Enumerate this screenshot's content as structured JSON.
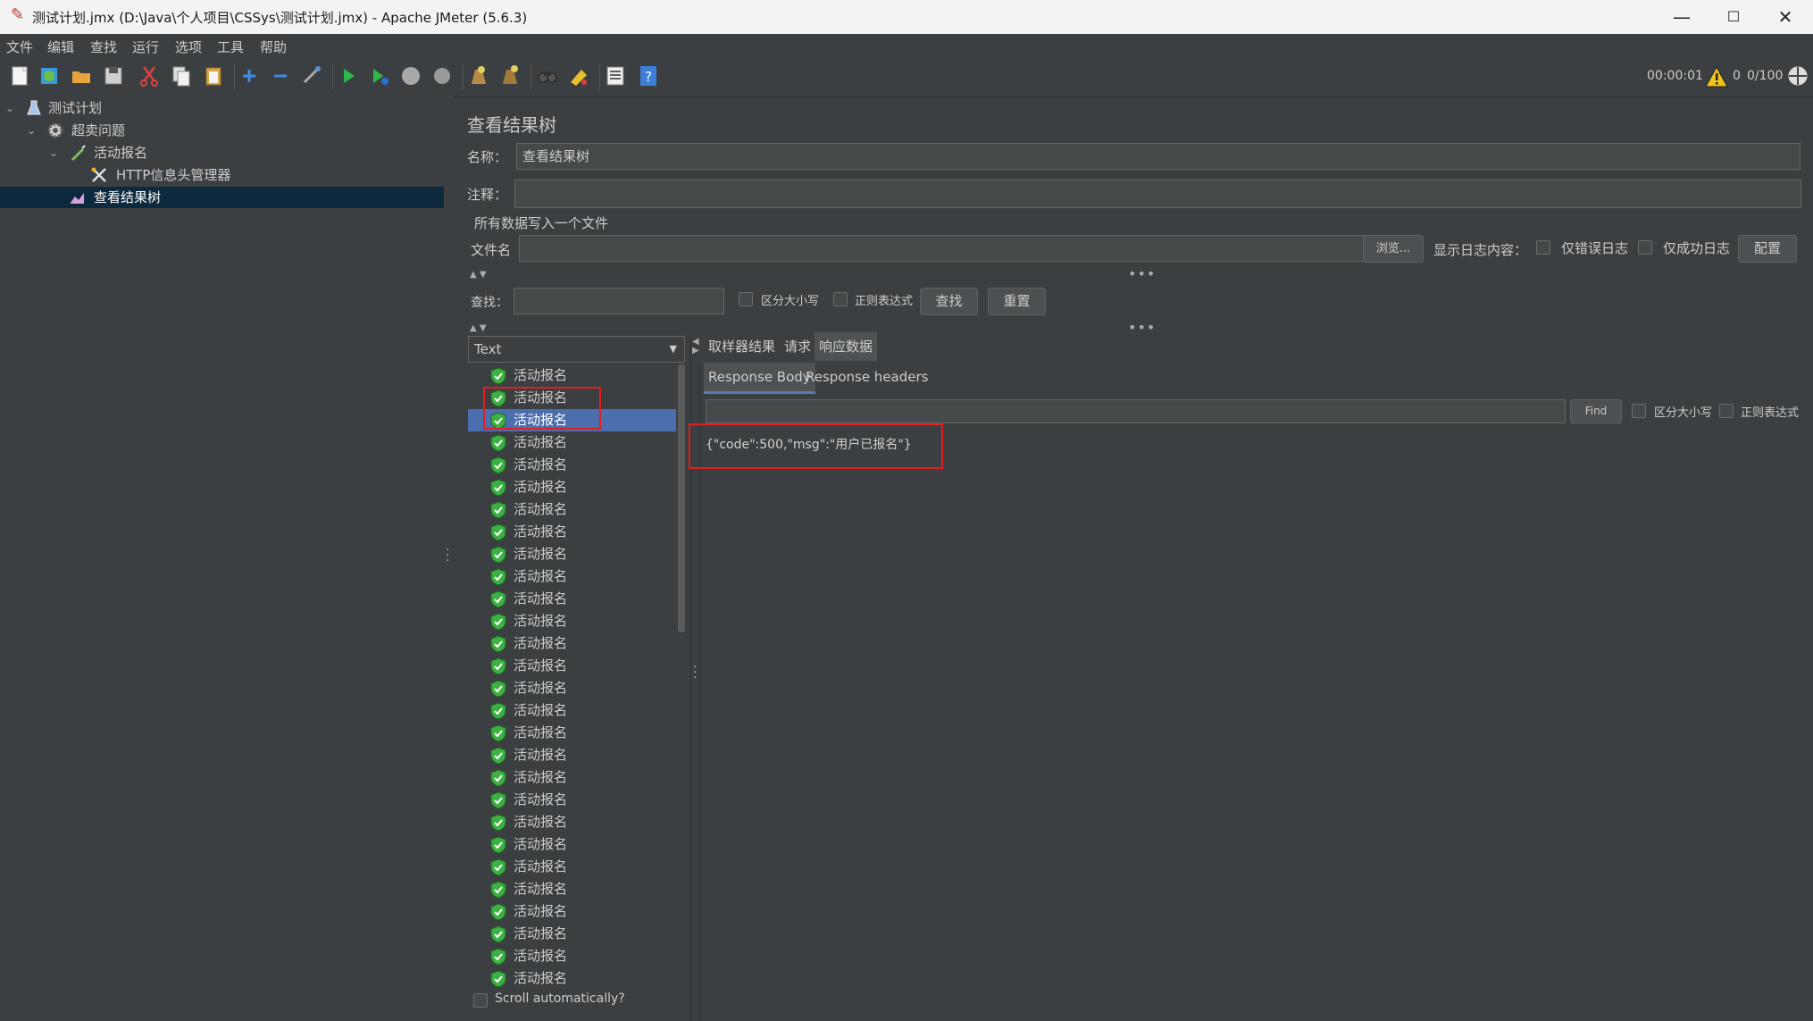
{
  "window": {
    "title": "测试计划.jmx (D:\\Java\\个人项目\\CSSys\\测试计划.jmx) - Apache JMeter (5.6.3)",
    "minimize": "—",
    "maximize": "☐",
    "close": "✕"
  },
  "menu": [
    "文件",
    "编辑",
    "查找",
    "运行",
    "选项",
    "工具",
    "帮助"
  ],
  "status": {
    "time": "00:00:01",
    "warnings": "0",
    "threads": "0/100"
  },
  "tree": {
    "nodes": [
      {
        "label": "测试计划",
        "icon": "test-plan-icon"
      },
      {
        "label": "超卖问题",
        "icon": "thread-group-gear-icon"
      },
      {
        "label": "活动报名",
        "icon": "http-sampler-pen-icon"
      },
      {
        "label": "HTTP信息头管理器",
        "icon": "header-manager-tools-icon"
      },
      {
        "label": "查看结果树",
        "icon": "view-results-tree-icon"
      }
    ]
  },
  "panel": {
    "heading": "查看结果树",
    "name_label": "名称：",
    "name_value": "查看结果树",
    "comment_label": "注释：",
    "comment_value": "",
    "file_section": "所有数据写入一个文件",
    "filename_label": "文件名",
    "filename_value": "",
    "browse_button": "浏览...",
    "log_label": "显示日志内容：",
    "errors_only": "仅错误日志",
    "success_only": "仅成功日志",
    "config_button": "配置",
    "search_label": "查找：",
    "search_value": "",
    "case_sensitive": "区分大小写",
    "regex": "正则表达式",
    "find_button": "查找",
    "reset_button": "重置",
    "renderer": "Text",
    "scroll_auto": "Scroll automatically?"
  },
  "results": {
    "items": [
      "活动报名",
      "活动报名",
      "活动报名",
      "活动报名",
      "活动报名",
      "活动报名",
      "活动报名",
      "活动报名",
      "活动报名",
      "活动报名",
      "活动报名",
      "活动报名",
      "活动报名",
      "活动报名",
      "活动报名",
      "活动报名",
      "活动报名",
      "活动报名",
      "活动报名",
      "活动报名",
      "活动报名",
      "活动报名",
      "活动报名",
      "活动报名",
      "活动报名",
      "活动报名",
      "活动报名",
      "活动报名"
    ],
    "selected_index": 2
  },
  "detail": {
    "tabs": [
      "取样器结果",
      "请求",
      "响应数据"
    ],
    "active_tab": 2,
    "subtabs": [
      "Response Body",
      "Response headers"
    ],
    "active_subtab": 0,
    "find_value": "",
    "find_button": "Find",
    "case_sensitive": "区分大小写",
    "regex": "正则表达式",
    "response_body": "{\"code\":500,\"msg\":\"用户已报名\"}"
  },
  "colors": {
    "background": "#3c3f41",
    "selection_blue": "#4b6eaf",
    "tree_selection": "#0d293e",
    "highlight_red": "#e02020",
    "success_green": "#3cb043"
  }
}
